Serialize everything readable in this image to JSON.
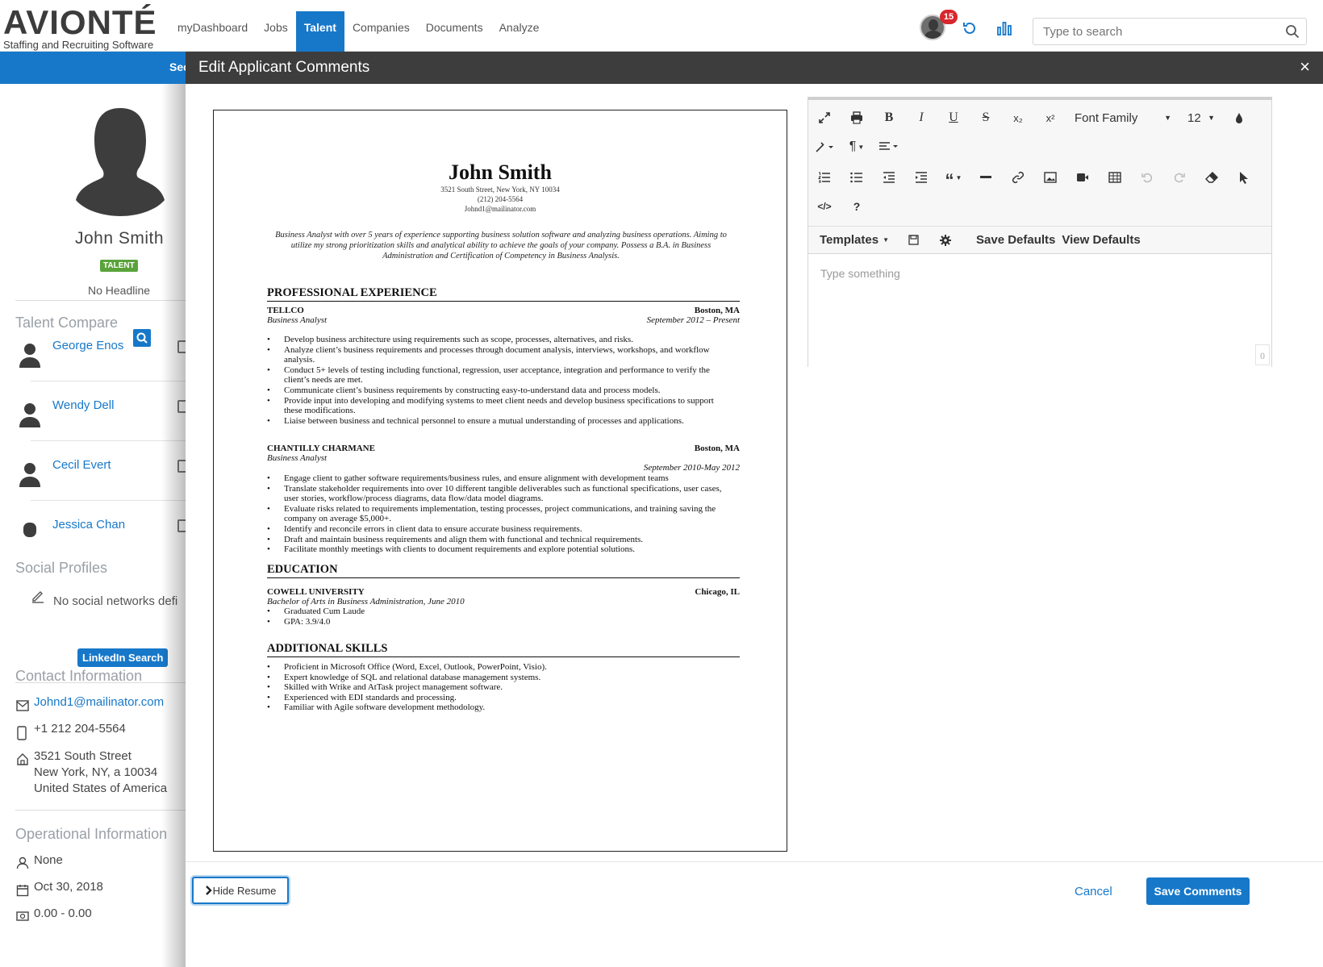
{
  "brand": {
    "name": "AVIONTÉ",
    "tagline": "Staffing and Recruiting Software"
  },
  "nav": {
    "items": [
      "myDashboard",
      "Jobs",
      "Talent",
      "Companies",
      "Documents",
      "Analyze"
    ],
    "active": "Talent"
  },
  "header": {
    "notification_count": "15",
    "search_placeholder": "Type to search"
  },
  "strip": {
    "label": "Sec"
  },
  "profile": {
    "name": "John Smith",
    "badge": "TALENT",
    "headline": "No Headline",
    "talent_compare_title": "Talent Compare",
    "compare": [
      "George Enos",
      "Wendy Dell",
      "Cecil Evert",
      "Jessica Chan"
    ],
    "social_title": "Social Profiles",
    "social_none": "No social networks defi",
    "linkedin_label": "LinkedIn Search",
    "contact_title": "Contact Information",
    "email": "Johnd1@mailinator.com",
    "phone": "+1 212 204-5564",
    "address_line1": "3521 South Street",
    "address_line2": "New York, NY, a 10034",
    "address_line3": "United States of America",
    "operational_title": "Operational Information",
    "op_none": "None",
    "op_date": "Oct 30, 2018",
    "op_rate": "0.00 - 0.00"
  },
  "modal": {
    "title": "Edit Applicant Comments",
    "close": "×",
    "hide_resume": "Hide Resume",
    "cancel": "Cancel",
    "save": "Save Comments"
  },
  "resume": {
    "name": "John Smith",
    "address": "3521 South Street, New York, NY 10034",
    "phone": "(212) 204-5564",
    "email": "Johnd1@mailinator.com",
    "summary": "Business Analyst with over 5 years of experience supporting business solution software and analyzing business operations. Aiming to utilize my strong prioritization skills and analytical ability to achieve the goals of your company. Possess a B.A. in Business Administration and Certification of Competency in Business Analysis.",
    "h_experience": "PROFESSIONAL EXPERIENCE",
    "job1": {
      "company": "TELLCO",
      "location": "Boston, MA",
      "role": "Business Analyst",
      "dates": "September 2012 – Present",
      "bullets": [
        "Develop business architecture using requirements such as scope, processes, alternatives, and risks.",
        "Analyze client’s business requirements and processes through document analysis, interviews, workshops, and workflow analysis.",
        "Conduct 5+ levels of testing including functional, regression, user acceptance, integration and performance to verify the client’s needs are met.",
        "Communicate client’s business requirements by constructing easy-to-understand data and process models.",
        "Provide input into developing and modifying systems to meet client needs and develop business specifications to support these modifications.",
        "Liaise between business and technical personnel to ensure a mutual understanding of processes and applications."
      ]
    },
    "job2": {
      "company": "CHANTILLY CHARMANE",
      "location": "Boston, MA",
      "role": "Business Analyst",
      "dates": "September 2010-May 2012",
      "bullets": [
        "Engage client to gather software requirements/business rules, and ensure alignment with development teams",
        "Translate stakeholder requirements into over 10 different tangible deliverables such as functional specifications, user cases, user stories, workflow/process diagrams, data flow/data model diagrams.",
        "Evaluate risks related to requirements implementation, testing processes, project communications, and training saving the company on average $5,000+.",
        "Identify and reconcile errors in client data to ensure accurate business requirements.",
        "Draft and maintain business requirements and align them with functional and technical requirements.",
        "Facilitate monthly meetings with clients to document requirements and explore potential solutions."
      ]
    },
    "h_education": "EDUCATION",
    "edu": {
      "school": "COWELL UNIVERSITY",
      "location": "Chicago, IL",
      "degree": "Bachelor of Arts in Business Administration, June 2010",
      "bullets": [
        "Graduated Cum Laude",
        "GPA: 3.9/4.0"
      ]
    },
    "h_skills": "ADDITIONAL SKILLS",
    "skills": [
      "Proficient in Microsoft Office (Word, Excel, Outlook, PowerPoint, Visio).",
      "Expert knowledge of SQL and relational database management systems.",
      "Skilled with Wrike and AtTask project management software.",
      "Experienced with EDI standards and processing.",
      "Familiar with Agile software development methodology."
    ]
  },
  "editor": {
    "font_family": "Font Family",
    "font_size": "12",
    "templates": "Templates",
    "save_defaults": "Save Defaults",
    "view_defaults": "View Defaults",
    "placeholder": "Type something",
    "char_count": "0",
    "bold": "B",
    "italic": "I",
    "underline": "U",
    "strike": "S",
    "sub": "x₂",
    "sup": "x²",
    "help": "?",
    "code": "</>"
  }
}
